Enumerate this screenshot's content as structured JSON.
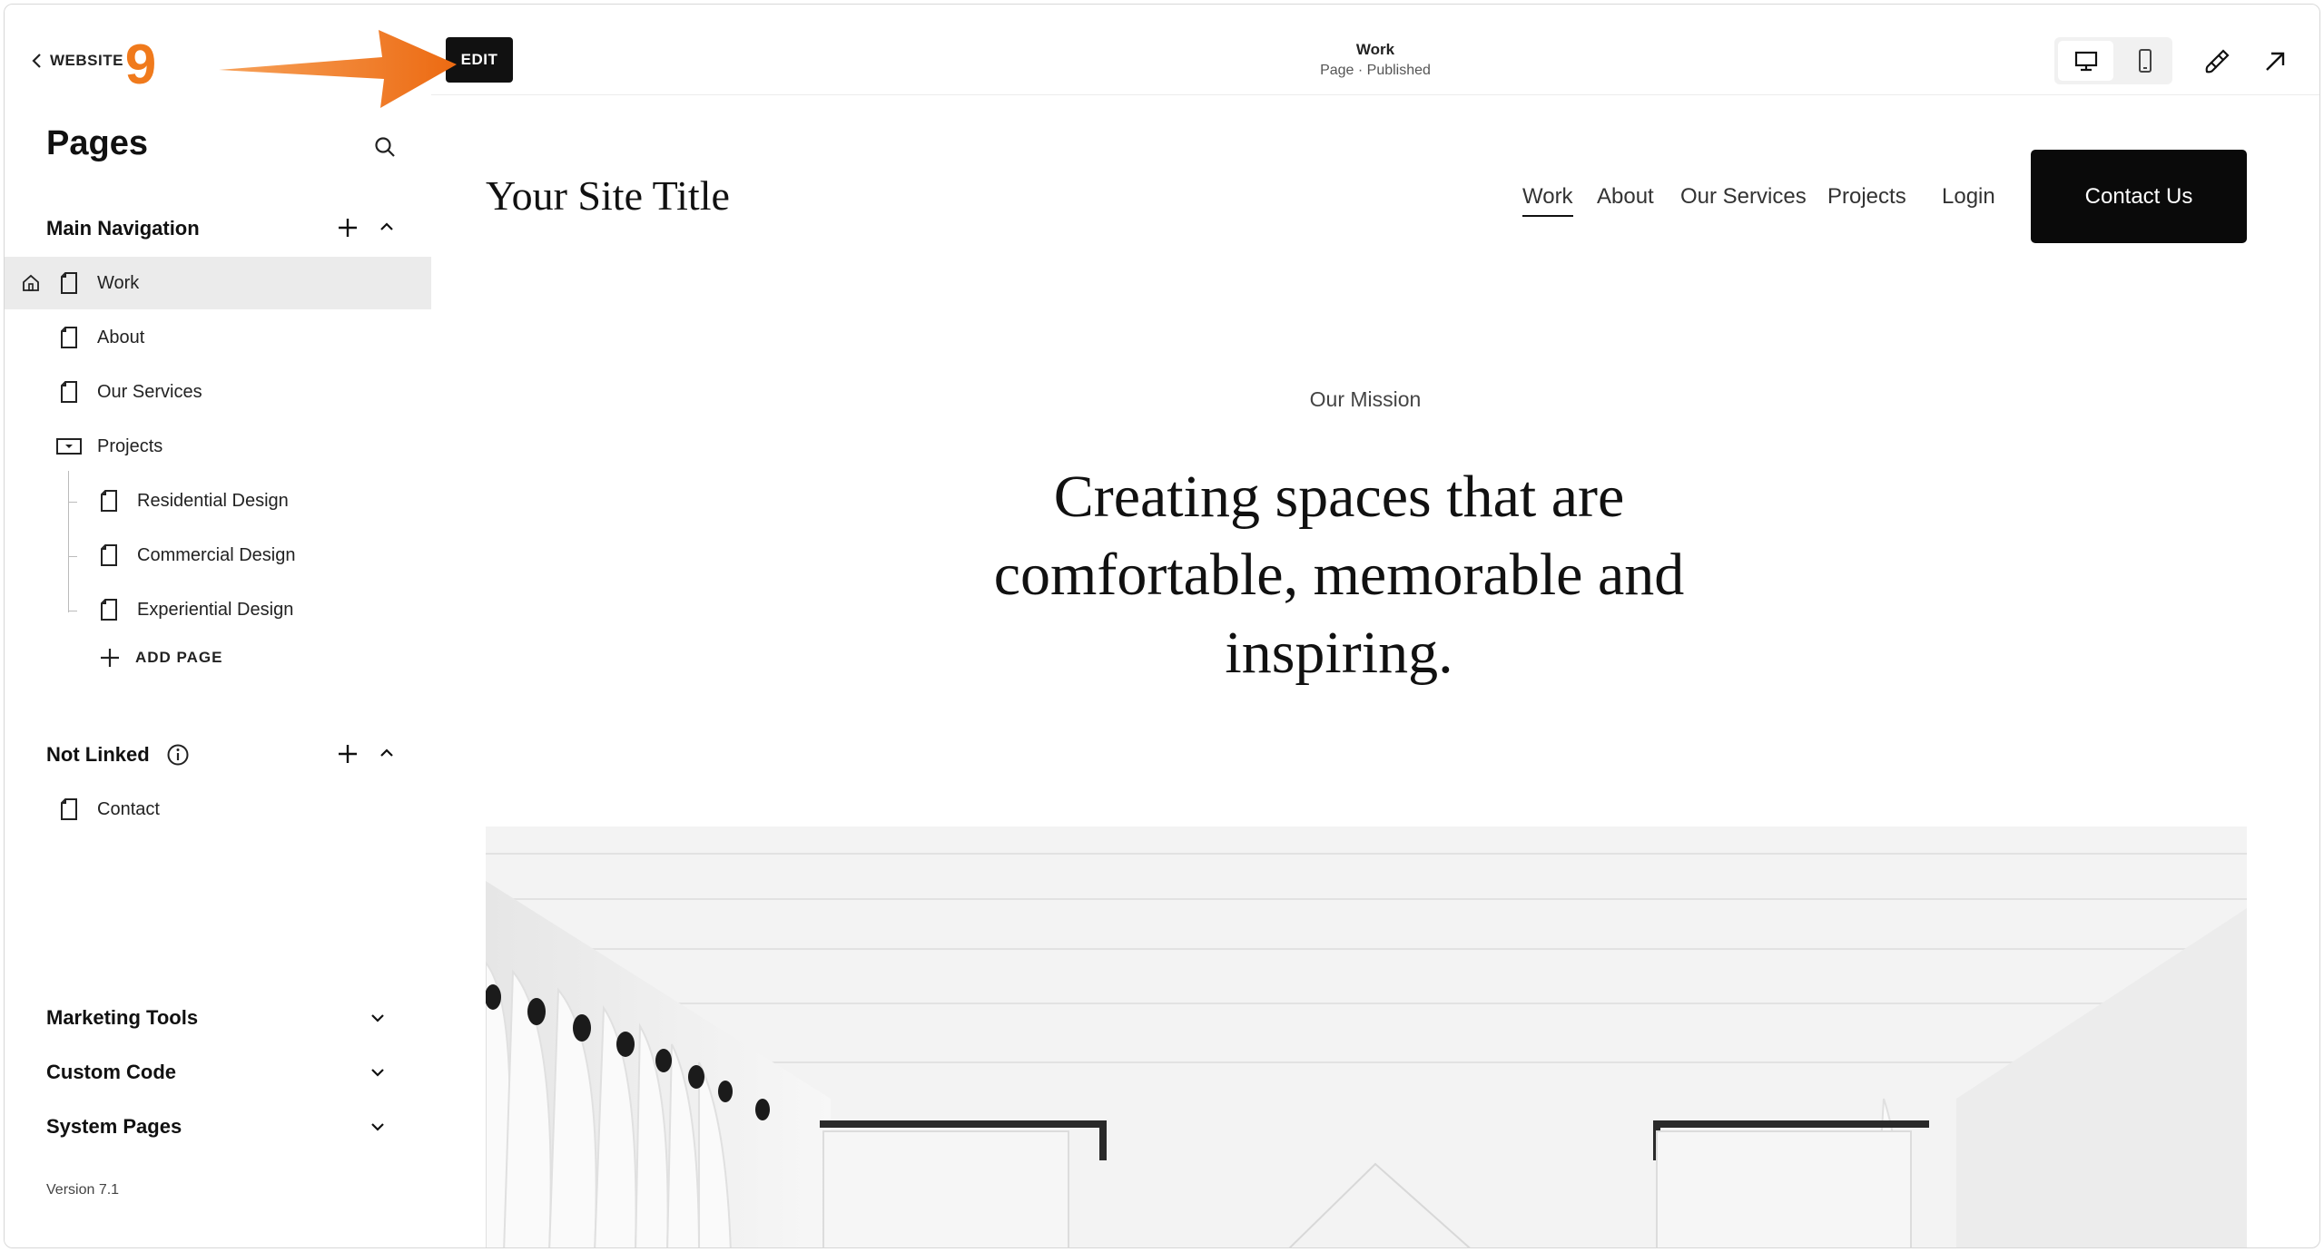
{
  "sidebar": {
    "back_label": "WEBSITE",
    "step_badge": "9",
    "title": "Pages",
    "main_nav": {
      "label": "Main Navigation",
      "items": [
        {
          "label": "Work",
          "active": true,
          "home": true
        },
        {
          "label": "About"
        },
        {
          "label": "Our Services"
        },
        {
          "label": "Projects",
          "folder": true
        },
        {
          "label": "Residential Design",
          "child": true
        },
        {
          "label": "Commercial Design",
          "child": true
        },
        {
          "label": "Experiential Design",
          "child": true
        }
      ],
      "add_page": "ADD PAGE"
    },
    "not_linked": {
      "label": "Not Linked",
      "items": [
        {
          "label": "Contact"
        }
      ]
    },
    "marketing_tools": "Marketing Tools",
    "custom_code": "Custom Code",
    "system_pages": "System Pages",
    "version": "Version 7.1"
  },
  "topbar": {
    "edit_label": "EDIT",
    "page_name": "Work",
    "page_status": "Page · Published"
  },
  "preview": {
    "site_title": "Your Site Title",
    "nav": [
      "Work",
      "About",
      "Our Services",
      "Projects"
    ],
    "login": "Login",
    "contact_button": "Contact Us",
    "mission_label": "Our Mission",
    "headline": "Creating spaces that are comfortable, memorable and inspiring."
  },
  "colors": {
    "annotation": "#f07a1c",
    "active_row": "#ebebeb",
    "button_dark": "#0a0a0a"
  }
}
